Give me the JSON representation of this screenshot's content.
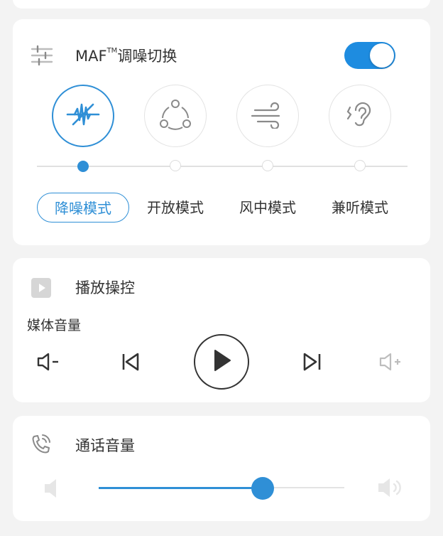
{
  "anc": {
    "title": "MAF",
    "title_tm": "TM",
    "title_suffix": "调噪切换",
    "toggle_on": true,
    "selected_mode_index": 0,
    "modes": [
      {
        "label": "降噪模式",
        "icon": "noise-cancel-icon"
      },
      {
        "label": "开放模式",
        "icon": "open-share-icon"
      },
      {
        "label": "风中模式",
        "icon": "wind-icon"
      },
      {
        "label": "兼听模式",
        "icon": "ear-icon"
      }
    ]
  },
  "playback": {
    "title": "播放操控",
    "media_volume_label": "媒体音量",
    "controls": [
      "volume-down-icon",
      "previous-track-icon",
      "play-icon",
      "next-track-icon",
      "volume-up-icon"
    ]
  },
  "call": {
    "title": "通话音量",
    "volume_fraction": 0.7
  },
  "colors": {
    "accent": "#2f8fd6",
    "toggle": "#1e8ce0",
    "background": "#f3f3f3",
    "card": "#ffffff"
  }
}
